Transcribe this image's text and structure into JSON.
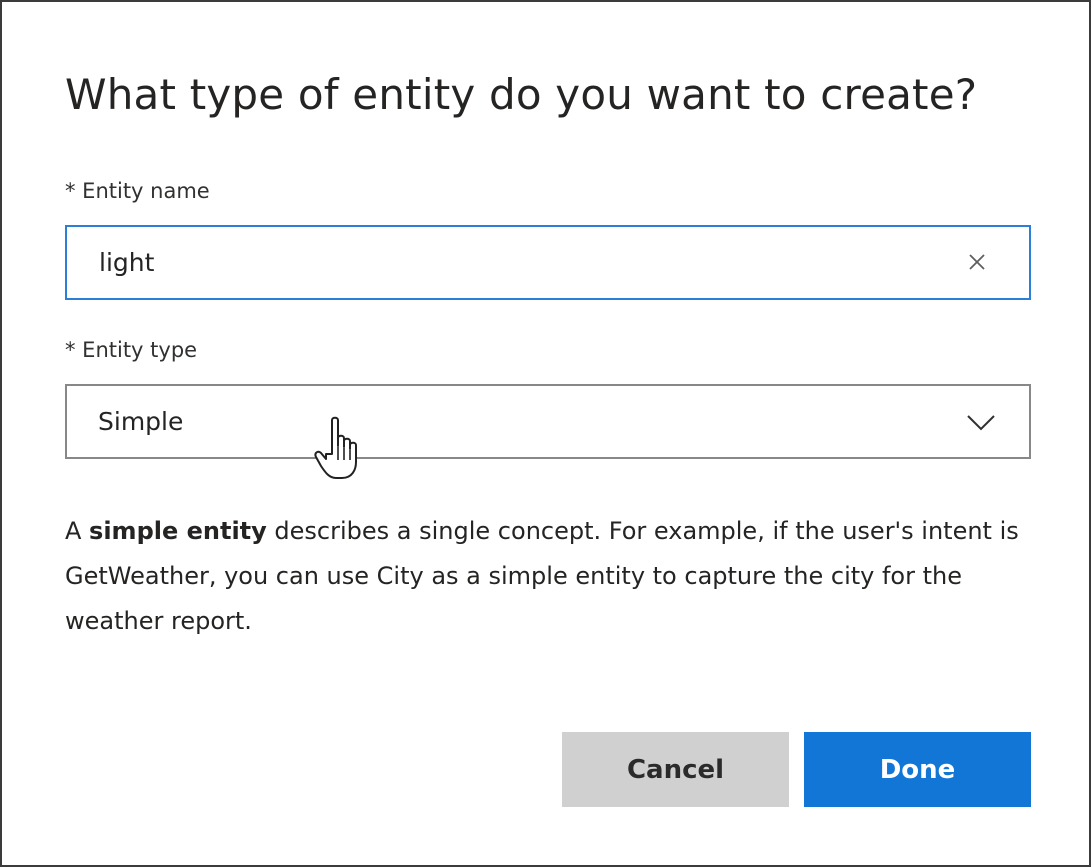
{
  "dialog": {
    "title": "What type of entity do you want to create?",
    "entity_name": {
      "label": "* Entity name",
      "value": "light",
      "clear_icon": "close-icon"
    },
    "entity_type": {
      "label": "* Entity type",
      "selected": "Simple",
      "dropdown_icon": "chevron-down-icon"
    },
    "description": {
      "prefix": "A ",
      "bold": "simple entity",
      "suffix": " describes a single concept. For example, if the user's intent is GetWeather, you can use City as a simple entity to capture the city for the weather report."
    },
    "buttons": {
      "cancel": "Cancel",
      "done": "Done"
    }
  },
  "colors": {
    "accent": "#1276d6",
    "focus_border": "#2b7fd6",
    "cancel_bg": "#d0d0d0",
    "border": "#8a8886"
  },
  "cursor_icon": "hand-pointer-icon"
}
